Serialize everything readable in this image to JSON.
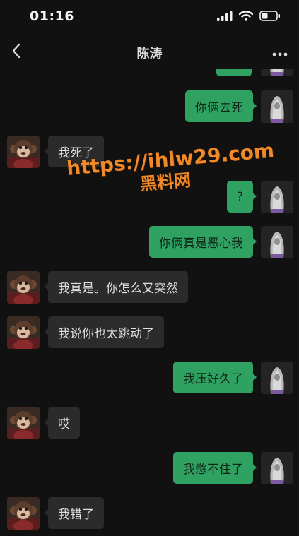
{
  "status_bar": {
    "time": "01:16"
  },
  "nav": {
    "title": "陈涛"
  },
  "watermark": {
    "url": "https://ihlw29.com",
    "name": "黑料网"
  },
  "messages": [
    {
      "side": "right",
      "text": "你俩去死"
    },
    {
      "side": "left",
      "text": "我死了"
    },
    {
      "side": "right",
      "text": "?"
    },
    {
      "side": "right",
      "text": "你俩真是恶心我"
    },
    {
      "side": "left",
      "text": "我真是。你怎么又突然"
    },
    {
      "side": "left",
      "text": "我说你也太跳动了"
    },
    {
      "side": "right",
      "text": "我压好久了"
    },
    {
      "side": "left",
      "text": "哎"
    },
    {
      "side": "right",
      "text": "我憋不住了"
    },
    {
      "side": "left",
      "text": "我错了"
    }
  ],
  "colors": {
    "background": "#111111",
    "outgoing_bubble": "#2fa261",
    "incoming_bubble": "#2b2b2b",
    "watermark": "#f0892a"
  }
}
